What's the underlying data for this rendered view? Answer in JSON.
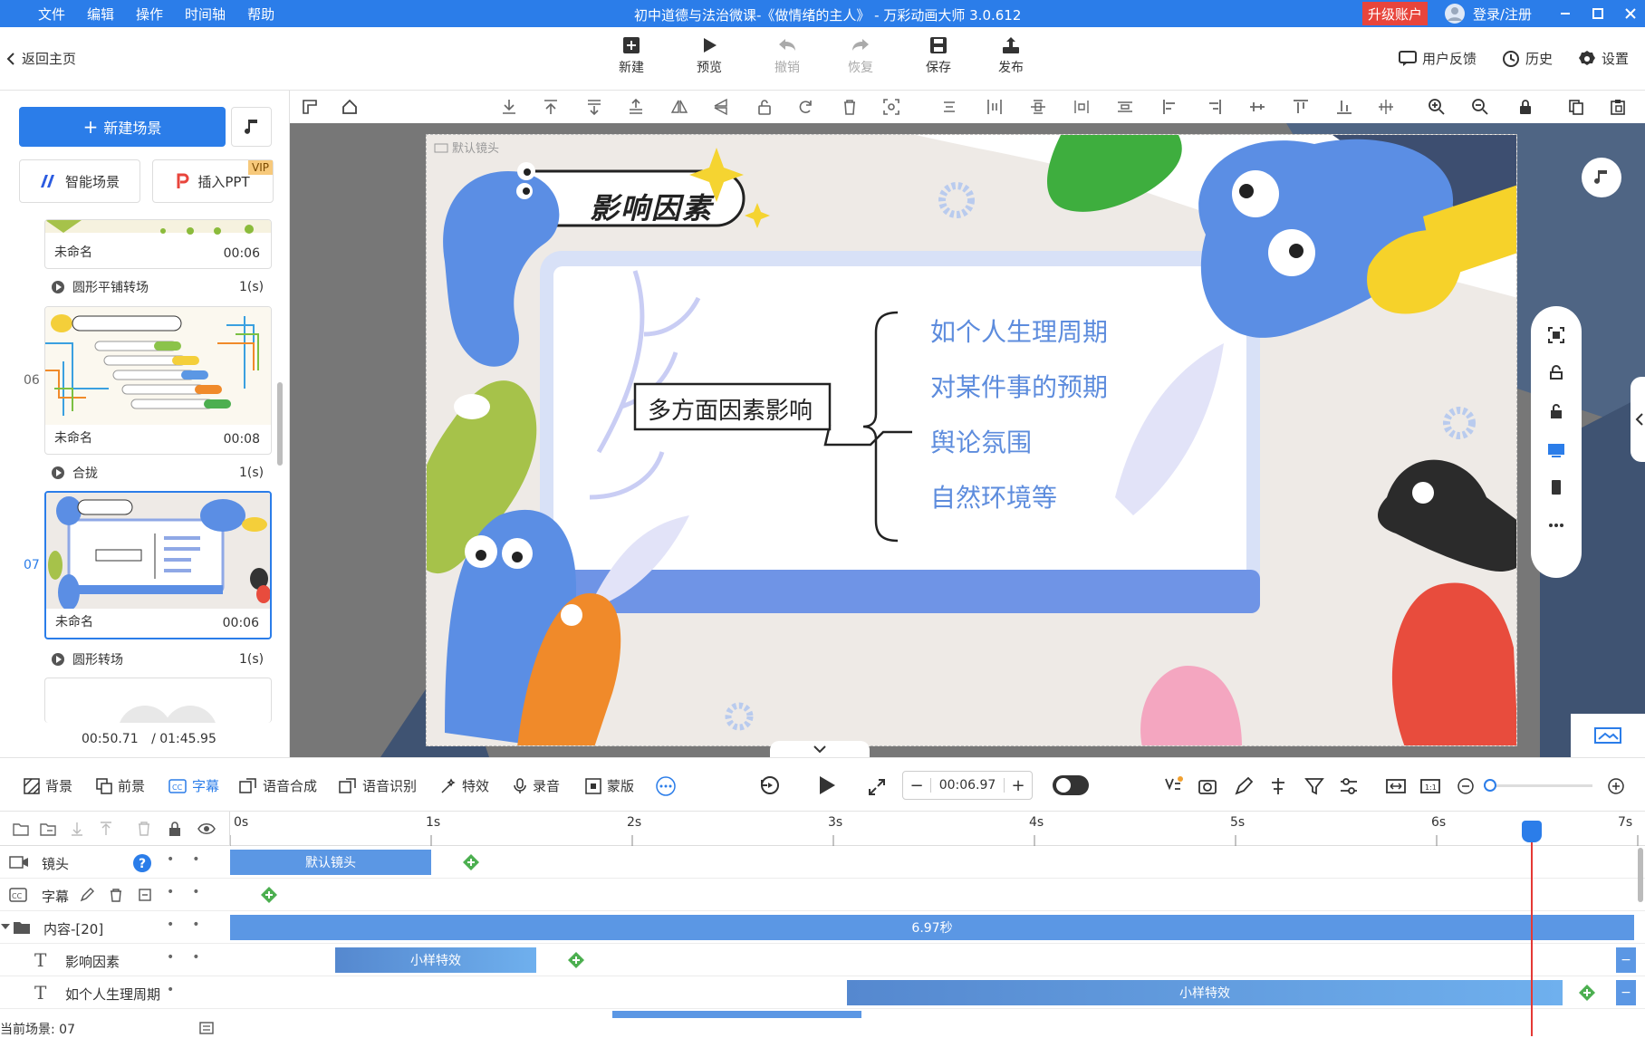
{
  "titlebar": {
    "menu": [
      "文件",
      "编辑",
      "操作",
      "时间轴",
      "帮助"
    ],
    "title": "初中道德与法治微课-《做情绪的主人》 - 万彩动画大师 3.0.612",
    "upgrade": "升级账户",
    "login": "登录/注册"
  },
  "toolbar": {
    "back": "返回主页",
    "buttons": [
      "新建",
      "预览",
      "撤销",
      "恢复",
      "保存",
      "发布"
    ],
    "right": [
      "用户反馈",
      "历史",
      "设置"
    ]
  },
  "left": {
    "new_scene": "新建场景",
    "smart_scene": "智能场景",
    "insert_ppt": "插入PPT",
    "vip": "VIP",
    "scenes": [
      {
        "index": "",
        "name": "未命名",
        "duration": "00:06"
      },
      {
        "index": "06",
        "name": "未命名",
        "duration": "00:08"
      },
      {
        "index": "07",
        "name": "未命名",
        "duration": "00:06"
      }
    ],
    "transitions": [
      {
        "name": "圆形平铺转场",
        "time": "1(s)"
      },
      {
        "name": "合拢",
        "time": "1(s)"
      },
      {
        "name": "圆形转场",
        "time": "1(s)"
      }
    ],
    "current_time": "00:50.71",
    "total_time": "/ 01:45.95"
  },
  "stage": {
    "camera_label": "默认镜头",
    "title": "影响因素",
    "center": "多方面因素影响",
    "items": [
      "如个人生理周期",
      "对某件事的预期",
      "舆论氛围",
      "自然环境等"
    ]
  },
  "bottom_tools": {
    "items": [
      "背景",
      "前景",
      "字幕",
      "语音合成",
      "语音识别",
      "特效",
      "录音",
      "蒙版"
    ],
    "time_value": "00:06.97"
  },
  "timeline": {
    "ruler": [
      "0s",
      "1s",
      "2s",
      "3s",
      "4s",
      "5s",
      "6s",
      "7s"
    ],
    "tracks": [
      {
        "label": "镜头",
        "clip": "默认镜头"
      },
      {
        "label": "字幕",
        "clip": ""
      },
      {
        "label": "内容-[20]",
        "clip": "6.97秒"
      },
      {
        "label": "影响因素",
        "clip": "小样特效"
      },
      {
        "label": "如个人生理周期",
        "clip": "小样特效"
      }
    ],
    "current_scene": "当前场景: 07"
  },
  "colors": {
    "accent": "#2b7de9",
    "upgrade": "#e8453c",
    "clip": "#5b97e4",
    "keyframe": "#4caf50"
  }
}
